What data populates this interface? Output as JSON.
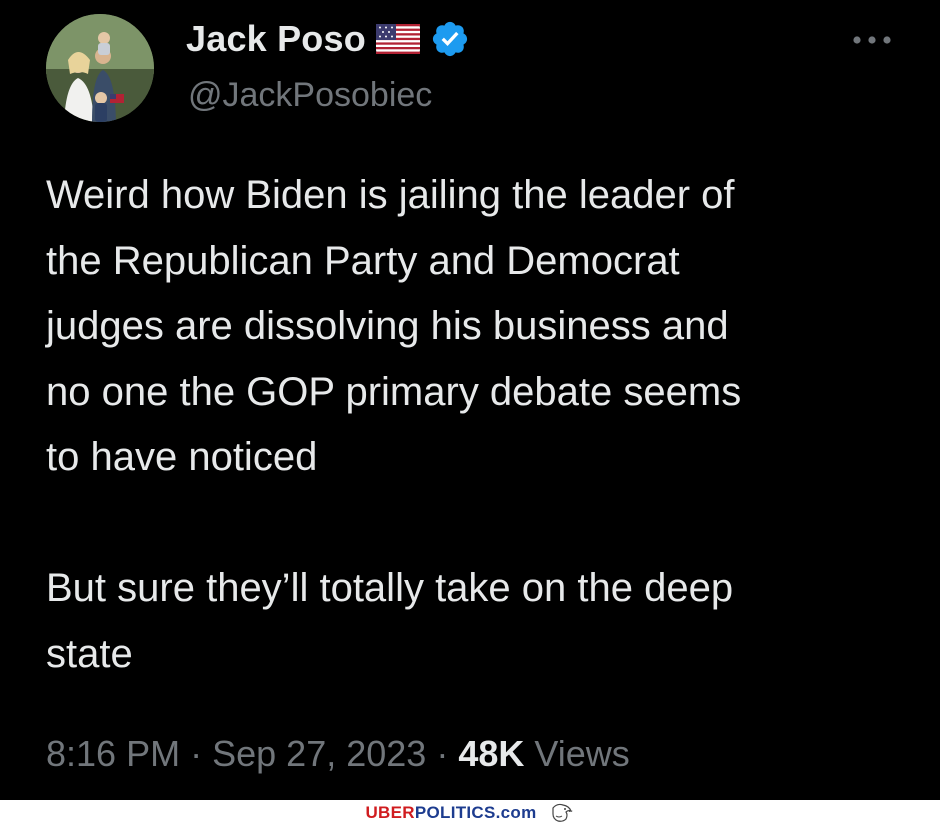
{
  "tweet": {
    "display_name": "Jack Poso",
    "handle": "@JackPosobiec",
    "body": "Weird how Biden is jailing the leader of\nthe Republican Party and Democrat\njudges are dissolving his business and\nno one the GOP primary debate seems\nto have noticed\n\nBut sure they’ll totally take on the deep\nstate",
    "time": "8:16 PM",
    "separator": "·",
    "date": "Sep 27, 2023",
    "views_count": "48K",
    "views_label": "Views",
    "icons": {
      "avatar": "profile-photo",
      "flag": "us-flag-icon",
      "verified": "verified-badge-icon",
      "more": "more-options-icon"
    }
  },
  "watermark": {
    "brand_part1": "UBER",
    "brand_part2": "POLITICS.com",
    "icon": "eagle-icon"
  },
  "colors": {
    "background": "#000000",
    "text_primary": "#e7e9ea",
    "text_secondary": "#71767b",
    "verified_blue": "#1d9bf0",
    "brand_red": "#d01c1f",
    "brand_blue": "#1d3c8f"
  }
}
